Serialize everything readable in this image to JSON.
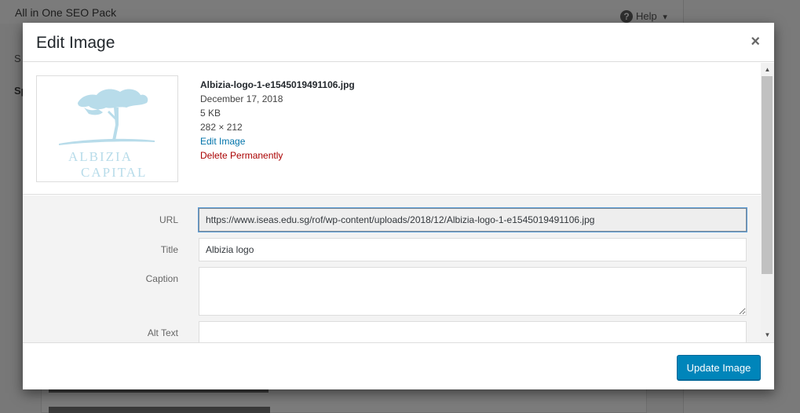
{
  "background": {
    "page_title": "All in One SEO Pack",
    "help_label": "Help",
    "help_caret": "▾",
    "section_label_1": "S",
    "section_label_2": "Sp"
  },
  "modal": {
    "title": "Edit Image",
    "close_glyph": "×",
    "attachment": {
      "filename": "Albizia-logo-1-e1545019491106.jpg",
      "date": "December 17, 2018",
      "filesize": "5 KB",
      "dimensions": "282 × 212",
      "edit_link": "Edit Image",
      "delete_link": "Delete Permanently"
    },
    "thumbnail": {
      "logo_line1": "ALBIZIA",
      "logo_line2": "CAPITAL",
      "logo_color": "#b8dcea"
    },
    "fields": {
      "url_label": "URL",
      "url_value": "https://www.iseas.edu.sg/rof/wp-content/uploads/2018/12/Albizia-logo-1-e1545019491106.jpg",
      "title_label": "Title",
      "title_value": "Albizia logo",
      "caption_label": "Caption",
      "caption_value": "",
      "alt_label": "Alt Text",
      "alt_value": ""
    },
    "footer": {
      "update_button": "Update Image"
    }
  },
  "colors": {
    "primary_button": "#0085ba",
    "link": "#0073aa",
    "delete": "#aa0000"
  }
}
